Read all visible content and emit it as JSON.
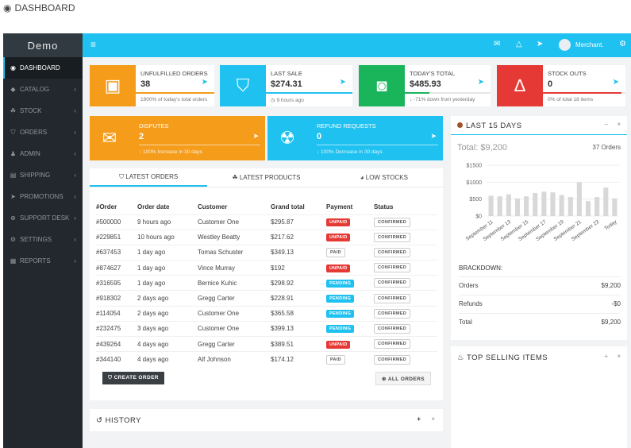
{
  "page_caption": "DASHBOARD",
  "sidebar": {
    "brand": "Demo",
    "items": [
      {
        "label": "DASHBOARD",
        "icon": "◉",
        "chev": ""
      },
      {
        "label": "CATALOG",
        "icon": "◆",
        "chev": "‹"
      },
      {
        "label": "STOCK",
        "icon": "☘",
        "chev": "‹"
      },
      {
        "label": "ORDERS",
        "icon": "⛉",
        "chev": "‹"
      },
      {
        "label": "ADMIN",
        "icon": "♟",
        "chev": "‹"
      },
      {
        "label": "SHIPPING",
        "icon": "▤",
        "chev": "‹"
      },
      {
        "label": "PROMOTIONS",
        "icon": "➤",
        "chev": "‹"
      },
      {
        "label": "SUPPORT DESK",
        "icon": "⊕",
        "chev": "‹"
      },
      {
        "label": "SETTINGS",
        "icon": "⚙",
        "chev": "‹"
      },
      {
        "label": "REPORTS",
        "icon": "▦",
        "chev": "‹"
      }
    ]
  },
  "topbar": {
    "menu_icon": "≡",
    "user_name": "Merchant.",
    "icons": {
      "mail": "✉",
      "bell": "△",
      "megaphone": "➤",
      "settings": "⚙"
    }
  },
  "stats": [
    {
      "title": "UNFULFILLED ORDERS",
      "value": "38",
      "sub": "1900% of today's total orders",
      "color": "#f59c1a",
      "icon": "▣",
      "bar": "#f59c1a",
      "fill": 1.0
    },
    {
      "title": "LAST SALE",
      "value": "$274.31",
      "sub": "◷ 9 hours ago",
      "color": "#1ec1f0",
      "icon": "⛉",
      "bar": "#1ec1f0",
      "fill": 1.0
    },
    {
      "title": "TODAY'S TOTAL",
      "value": "$485.93",
      "sub": "↓ -71% down from yesterday",
      "color": "#1ab45a",
      "icon": "◙",
      "bar": "#1ab45a",
      "fill": 0.29
    },
    {
      "title": "STOCK OUTS",
      "value": "0",
      "sub": "0% of total 18 items",
      "color": "#e53935",
      "icon": "∆",
      "bar": "#e53935",
      "fill": 0.95
    }
  ],
  "colorboxes": [
    {
      "title": "DISPUTES",
      "value": "2",
      "sub": "↑ 100% Increase in 30 days",
      "color": "#f59c1a",
      "icon": "✉",
      "arrow": "➤"
    },
    {
      "title": "REFUND REQUESTS",
      "value": "0",
      "sub": "↓ 100% Decrease in 30 days",
      "color": "#1ec1f0",
      "icon": "☢",
      "arrow": "➤"
    }
  ],
  "tabs": [
    "LATEST ORDERS",
    "LATEST PRODUCTS",
    "LOW STOCKS"
  ],
  "table": {
    "headers": [
      "#Order",
      "Order date",
      "Customer",
      "Grand total",
      "Payment",
      "Status"
    ],
    "rows": [
      [
        "#500000",
        "9 hours ago",
        "Customer One",
        "$295.87",
        "UNPAID",
        "CONFIRMED"
      ],
      [
        "#229851",
        "10 hours ago",
        "Westley Beatty",
        "$217.62",
        "UNPAID",
        "CONFIRMED"
      ],
      [
        "#637453",
        "1 day ago",
        "Tomas Schuster",
        "$349.13",
        "PAID",
        "CONFIRMED"
      ],
      [
        "#874627",
        "1 day ago",
        "Vince Murray",
        "$192",
        "UNPAID",
        "CONFIRMED"
      ],
      [
        "#316595",
        "1 day ago",
        "Bernice Kuhic",
        "$298.92",
        "PENDING",
        "CONFIRMED"
      ],
      [
        "#918302",
        "2 days ago",
        "Gregg Carter",
        "$228.91",
        "PENDING",
        "CONFIRMED"
      ],
      [
        "#114054",
        "2 days ago",
        "Customer One",
        "$365.58",
        "PENDING",
        "CONFIRMED"
      ],
      [
        "#232475",
        "3 days ago",
        "Customer One",
        "$399.13",
        "PENDING",
        "CONFIRMED"
      ],
      [
        "#439264",
        "4 days ago",
        "Gregg Carter",
        "$389.51",
        "UNPAID",
        "CONFIRMED"
      ],
      [
        "#344140",
        "4 days ago",
        "Alf Johnson",
        "$174.12",
        "PAID",
        "CONFIRMED"
      ]
    ]
  },
  "buttons": {
    "create": "⛉ CREATE ORDER",
    "all": "⊕ ALL ORDERS"
  },
  "last15": {
    "title": "LAST 15 DAYS",
    "total": "Total: $9,200",
    "orders": "37 Orders",
    "breakdown_label": "BRACKDOWN:",
    "breakdown": [
      {
        "k": "Orders",
        "v": "$9,200"
      },
      {
        "k": "Refunds",
        "v": "-$0"
      },
      {
        "k": "Total",
        "v": "$9,200"
      }
    ]
  },
  "top_selling": {
    "title": "TOP SELLING ITEMS"
  },
  "history": {
    "title": "HISTORY"
  },
  "chart_data": {
    "type": "bar",
    "title": "",
    "ytick_labels": [
      "$1500",
      "$1000",
      "$500",
      "$0"
    ],
    "yticks": [
      1500,
      1000,
      500,
      0
    ],
    "ylim": [
      0,
      1500
    ],
    "xtick_labels": [
      "September 11",
      "September 13",
      "September 15",
      "September 17",
      "September 19",
      "September 21",
      "September 23",
      "Today"
    ],
    "categories": [
      "September 11",
      "September 12",
      "September 13",
      "September 14",
      "September 15",
      "September 16",
      "September 17",
      "September 18",
      "September 19",
      "September 20",
      "September 21",
      "September 22",
      "September 23",
      "September 24",
      "Today"
    ],
    "values": [
      600,
      580,
      640,
      520,
      580,
      680,
      720,
      700,
      620,
      560,
      1000,
      440,
      560,
      840,
      520
    ],
    "color": "#d8d8d8",
    "grid": true
  }
}
